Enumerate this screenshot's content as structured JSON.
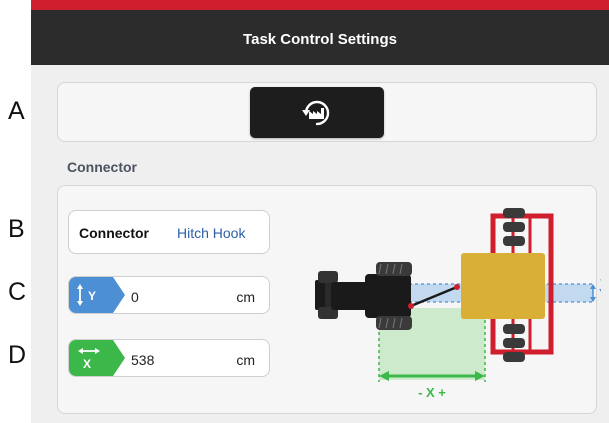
{
  "annotations": [
    "A",
    "B",
    "C",
    "D"
  ],
  "header": {
    "title": "Task Control Settings"
  },
  "toolbar": {
    "reset_icon": "factory-reset-icon"
  },
  "connector_section": {
    "title": "Connector",
    "connector": {
      "label": "Connector",
      "value": "Hitch Hook"
    },
    "offset_y": {
      "icon": "y-offset-icon",
      "icon_letter": "Y",
      "value": "0",
      "unit": "cm"
    },
    "offset_x": {
      "icon": "x-offset-icon",
      "icon_letter": "X",
      "value": "538",
      "unit": "cm"
    }
  },
  "diagram": {
    "y_label": "Y",
    "y_plus": "+",
    "y_minus": "-",
    "x_label": "- X +"
  },
  "colors": {
    "accent_red": "#cf1f2e",
    "header_dark": "#2c2c2c",
    "y_tag_blue": "#4d8fd4",
    "x_tag_green": "#3cb84a",
    "value_blue": "#2d5fa6",
    "implement_yellow": "#d9b035"
  }
}
